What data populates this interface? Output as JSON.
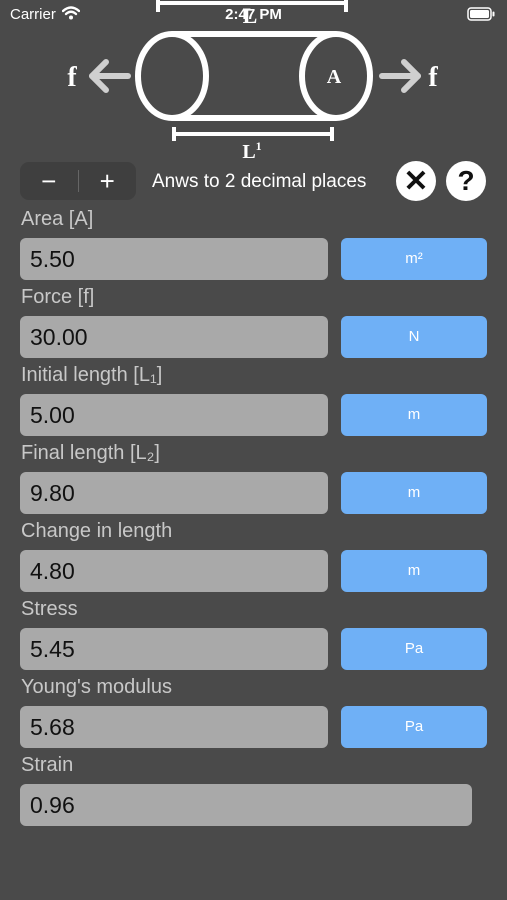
{
  "status_bar": {
    "carrier": "Carrier",
    "time": "2:47 PM"
  },
  "diagram": {
    "force_left": "f",
    "force_right": "f",
    "area_label": "A",
    "initial_length_label": "L",
    "final_length_label": "L",
    "final_length_sup": "1"
  },
  "toolbar": {
    "minus": "−",
    "plus": "+",
    "decimals_text": "Anws to 2 decimal places",
    "clear_icon": "✕",
    "help_icon": "?"
  },
  "fields": {
    "area": {
      "label": "Area [A]",
      "value": "5.50",
      "unit": "m²"
    },
    "force": {
      "label": "Force [f]",
      "value": "30.00",
      "unit": "N"
    },
    "initial_length": {
      "label": "Initial length [L₁]",
      "value": "5.00",
      "unit": "m"
    },
    "final_length": {
      "label": "Final length [L₂]",
      "value": "9.80",
      "unit": "m"
    },
    "change_in_length": {
      "label": "Change in length",
      "value": "4.80",
      "unit": "m"
    },
    "stress": {
      "label": "Stress",
      "value": "5.45",
      "unit": "Pa"
    },
    "youngs_modulus": {
      "label": "Young's modulus",
      "value": "5.68",
      "unit": "Pa"
    },
    "strain": {
      "label": "Strain",
      "value": "0.96"
    }
  },
  "colors": {
    "background": "#4a4a4a",
    "value_box": "#a9a9a9",
    "unit_button": "#6fb0f6"
  }
}
